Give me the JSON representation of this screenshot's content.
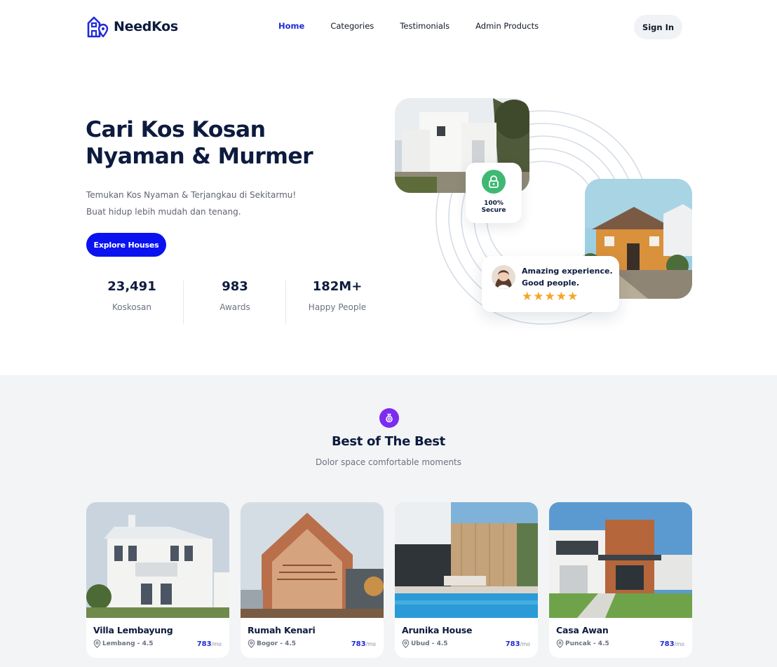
{
  "brand": {
    "name": "NeedKos",
    "accent": "#0a12f0",
    "logo_icon": "house-pin-icon"
  },
  "nav": {
    "items": [
      {
        "label": "Home",
        "active": true
      },
      {
        "label": "Categories",
        "active": false
      },
      {
        "label": "Testimonials",
        "active": false
      },
      {
        "label": "Admin Products",
        "active": false
      }
    ],
    "signin_label": "Sign In"
  },
  "hero": {
    "title_line1": "Cari Kos Kosan",
    "title_line2": "Nyaman & Murmer",
    "subtitle_line1": "Temukan Kos Nyaman & Terjangkau di Sekitarmu!",
    "subtitle_line2": "Buat hidup lebih mudah dan tenang.",
    "cta_label": "Explore Houses",
    "stats": [
      {
        "value": "23,491",
        "label": "Koskosan"
      },
      {
        "value": "983",
        "label": "Awards"
      },
      {
        "value": "182M+",
        "label": "Happy People"
      }
    ],
    "secure_badge": {
      "line1": "100%",
      "line2": "Secure",
      "icon": "lock-icon",
      "color": "#3fb874"
    },
    "review_card": {
      "line1": "Amazing experience.",
      "line2": "Good people.",
      "stars": "★★★★★",
      "rating": 5
    }
  },
  "best": {
    "icon": "ring-icon",
    "icon_color": "#7b2cf0",
    "title": "Best of The Best",
    "subtitle": "Dolor space comfortable moments",
    "cards": [
      {
        "name": "Villa Lembayung",
        "location": "Lembang - 4.5",
        "price": "783",
        "per": "/mo"
      },
      {
        "name": "Rumah Kenari",
        "location": "Bogor - 4.5",
        "price": "783",
        "per": "/mo"
      },
      {
        "name": "Arunika House",
        "location": "Ubud - 4.5",
        "price": "783",
        "per": "/mo"
      },
      {
        "name": "Casa Awan",
        "location": "Puncak - 4.5",
        "price": "783",
        "per": "/mo"
      }
    ]
  }
}
